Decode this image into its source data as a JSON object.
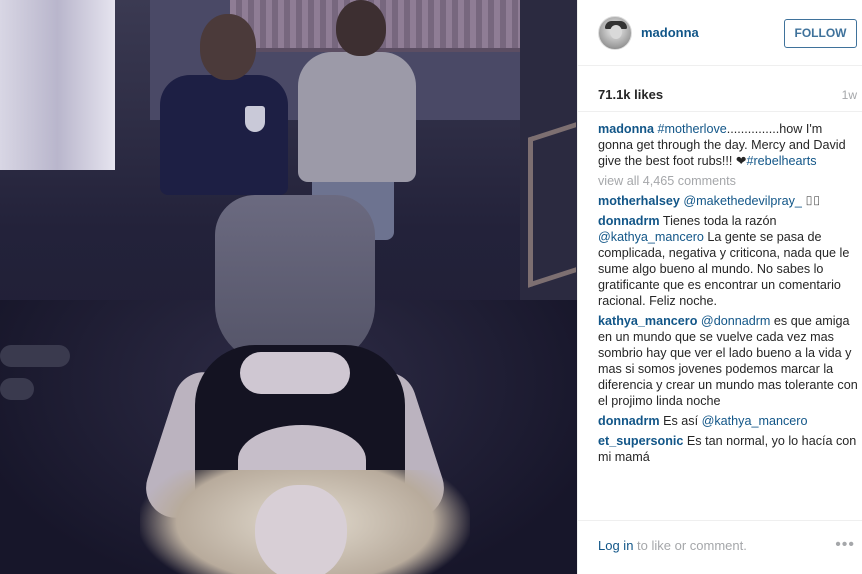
{
  "post": {
    "username": "madonna",
    "follow_label": "FOLLOW",
    "likes": "71.1k likes",
    "time_ago": "1w"
  },
  "caption": {
    "author": "madonna",
    "hashtag1": "#motherlove",
    "text1": "...............how I'm gonna get through the day. Mercy and David give the best foot rubs!!! ",
    "heart": "❤",
    "hashtag2": "#rebelhearts"
  },
  "view_all": "view all 4,465 comments",
  "comments": [
    {
      "author": "motherhalsey",
      "mention": "@makethedevilpray_",
      "text": " ⌷⌷"
    },
    {
      "author": "donnadrm",
      "mention": "",
      "text": "Tienes toda la razón ",
      "mention2": "@kathya_mancero",
      "text2": " La gente se pasa de complicada, negativa y criticona, nada que le sume algo bueno al mundo. No sabes lo gratificante que es encontrar un comentario racional. Feliz noche."
    },
    {
      "author": "kathya_mancero",
      "mention": "@donnadrm",
      "text": " es que amiga en un mundo que se vuelve cada vez mas sombrio hay que ver el lado bueno a la vida y mas si somos jovenes podemos marcar la diferencia y crear un mundo mas tolerante con el projimo linda noche"
    },
    {
      "author": "donnadrm",
      "mention": "",
      "text": "Es así ",
      "mention2": "@kathya_mancero",
      "text2": ""
    },
    {
      "author": "et_supersonic",
      "mention": "",
      "text": "Es tan normal, yo lo hacía con mi mamá"
    }
  ],
  "footer": {
    "login_link": "Log in",
    "login_text": " to like or comment.",
    "more_glyph": "•••"
  },
  "icons": {
    "more": "more-options-icon",
    "avatar": "profile-avatar"
  },
  "colors": {
    "link": "#125688",
    "follow_border": "#3f729b",
    "muted": "#a5a7aa"
  }
}
